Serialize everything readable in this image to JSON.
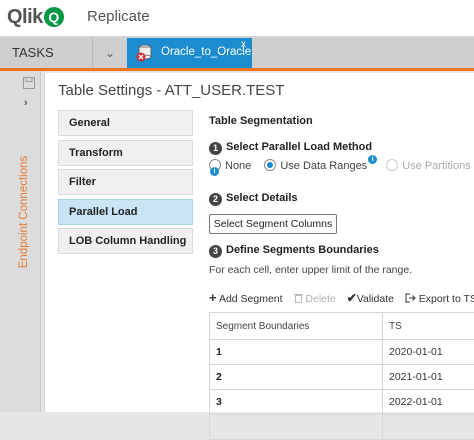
{
  "header": {
    "logo_text": "Qlik",
    "logo_q": "Q",
    "app_name": "Replicate"
  },
  "tabs_bar": {
    "tasks_label": "TASKS",
    "task_tab_label": "Oracle_to_Oracle",
    "task_tab_close": "x"
  },
  "left_panel": {
    "vertical_label": "Endpoint Connections"
  },
  "dialog": {
    "title": "Table Settings - ATT_USER.TEST",
    "nav": [
      "General",
      "Transform",
      "Filter",
      "Parallel Load",
      "LOB Column Handling"
    ],
    "active_nav": "Parallel Load",
    "section_title": "Table Segmentation",
    "step1": {
      "num": "1",
      "label": "Select Parallel Load Method"
    },
    "methods": [
      {
        "label": "None",
        "selected": false
      },
      {
        "label": "Use Data Ranges",
        "selected": true
      },
      {
        "label": "Use Partitions",
        "selected": false,
        "disabled": true
      }
    ],
    "step2": {
      "num": "2",
      "label": "Select Details"
    },
    "select_columns_button": "Select Segment Columns",
    "step3": {
      "num": "3",
      "label": "Define Segments Boundaries"
    },
    "step3_desc": "For each cell, enter upper limit of the range.",
    "toolbar": {
      "add": "Add Segment",
      "delete": "Delete",
      "validate": "Validate",
      "export": "Export to TSV"
    },
    "table": {
      "columns": [
        "Segment Boundaries",
        "TS"
      ],
      "rows": [
        [
          "1",
          "2020-01-01"
        ],
        [
          "2",
          "2021-01-01"
        ],
        [
          "3",
          "2022-01-01"
        ]
      ]
    }
  },
  "colors": {
    "accent_blue": "#1a8ccf",
    "brand_green": "#009845",
    "orange": "#f2711c",
    "active_nav": "#c8e4f5"
  }
}
